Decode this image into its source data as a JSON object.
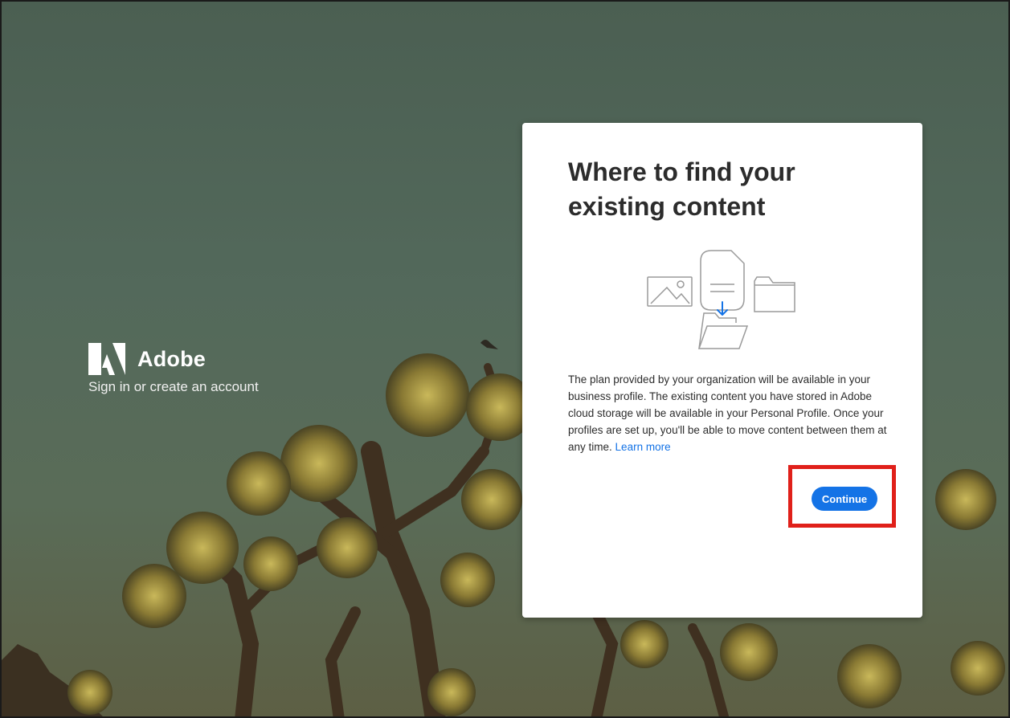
{
  "brand": {
    "logo_icon": "adobe-logo-icon",
    "name": "Adobe",
    "subtitle": "Sign in or create an account"
  },
  "dialog": {
    "title": "Where to find your existing content",
    "illustration_icon": "content-files-icon",
    "body": "The plan provided by your organization will be available in your business profile. The existing content you have stored in Adobe cloud storage will be available in your Personal Profile. Once your profiles are set up, you'll be able to move content between them at any time.",
    "learn_more_label": "Learn more",
    "continue_label": "Continue"
  },
  "colors": {
    "accent": "#1473e6",
    "highlight": "#e0201a",
    "background": "#53695b"
  }
}
